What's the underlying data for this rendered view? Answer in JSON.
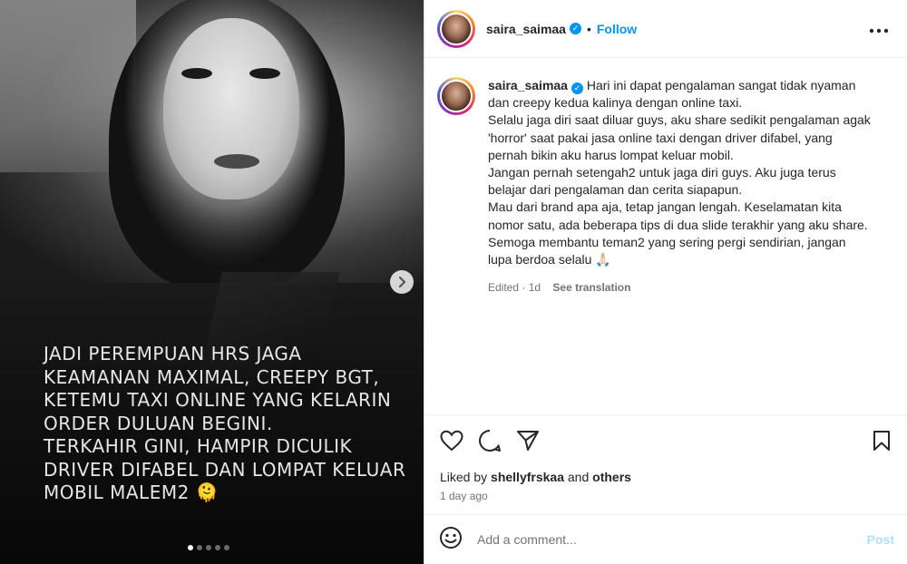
{
  "post": {
    "username": "saira_saimaa",
    "verified_icon": "verified-badge-icon",
    "follow_label": "Follow",
    "more_icon": "more-options-icon",
    "separator": "•"
  },
  "media": {
    "overlay_text": "JADI PEREMPUAN HRS JAGA\nKEAMANAN MAXIMAL, CREEPY BGT,\nKETEMU TAXI ONLINE YANG KELARIN\nORDER DULUAN BEGINI.\nTERKAHIR GINI, HAMPIR DICULIK\nDRIVER DIFABEL DAN LOMPAT KELUAR\nMOBIL MALEM2 🫠",
    "next_icon": "chevron-right-icon",
    "slide_count": 5,
    "active_slide": 1
  },
  "caption": {
    "username": "saira_saimaa",
    "lines": [
      "Hari ini dapat pengalaman sangat tidak nyaman",
      "dan creepy kedua kalinya dengan online taxi.",
      "Selalu jaga diri saat diluar guys, aku share sedikit pengalaman agak",
      "'horror' saat pakai jasa online taxi dengan driver difabel, yang",
      "pernah bikin aku harus lompat keluar mobil.",
      "Jangan pernah setengah2 untuk jaga diri guys. Aku juga terus",
      "belajar dari pengalaman dan cerita siapapun.",
      "Mau dari brand apa aja, tetap jangan lengah. Keselamatan kita",
      "nomor satu, ada beberapa tips di dua slide terakhir yang aku share.",
      "Semoga membantu teman2 yang sering pergi sendirian, jangan",
      "lupa berdoa selalu 🙏🏻"
    ],
    "edited": "Edited",
    "age": "1d",
    "dot": "·",
    "see_translation": "See translation"
  },
  "actions": {
    "like_icon": "heart-icon",
    "comment_icon": "comment-icon",
    "share_icon": "share-icon",
    "save_icon": "bookmark-icon"
  },
  "likes": {
    "prefix": "Liked by",
    "user": "shellyfrskaa",
    "and": "and",
    "others": "others"
  },
  "time_ago": "1 day ago",
  "comment_box": {
    "emoji_icon": "emoji-icon",
    "placeholder": "Add a comment...",
    "post_label": "Post"
  }
}
